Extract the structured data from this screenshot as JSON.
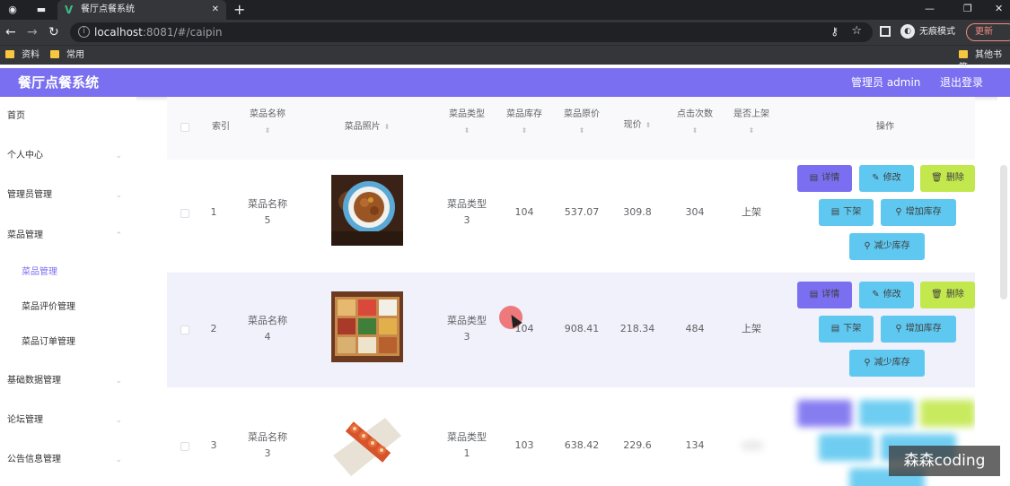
{
  "browser": {
    "tab_title": "餐厅点餐系统",
    "url_host": "localhost",
    "url_rest": ":8081/#/caipin",
    "incognito_label": "无痕模式",
    "update_label": "更新",
    "bookmarks": [
      "资料",
      "常用"
    ],
    "other_bookmarks": "其他书签"
  },
  "header": {
    "title": "餐厅点餐系统",
    "admin": "管理员 admin",
    "logout": "退出登录",
    "accent": "#7a6ff0"
  },
  "sidebar": {
    "items": [
      {
        "label": "首页"
      },
      {
        "label": "个人中心"
      },
      {
        "label": "管理员管理"
      },
      {
        "label": "菜品管理"
      },
      {
        "label": "菜品管理"
      },
      {
        "label": "菜品评价管理"
      },
      {
        "label": "菜品订单管理"
      },
      {
        "label": "基础数据管理"
      },
      {
        "label": "论坛管理"
      },
      {
        "label": "公告信息管理"
      }
    ]
  },
  "table": {
    "headers": {
      "index": "索引",
      "name": "菜品名称",
      "photo": "菜品照片",
      "type": "菜品类型",
      "stock": "菜品库存",
      "orig_price": "菜品原价",
      "price": "现价",
      "clicks": "点击次数",
      "onsale": "是否上架",
      "actions": "操作"
    },
    "rows": [
      {
        "index": "1",
        "name_a": "菜品名称",
        "name_b": "5",
        "type_a": "菜品类型",
        "type_b": "3",
        "stock": "104",
        "orig_price": "537.07",
        "price": "309.8",
        "clicks": "304",
        "onsale": "上架"
      },
      {
        "index": "2",
        "name_a": "菜品名称",
        "name_b": "4",
        "type_a": "菜品类型",
        "type_b": "3",
        "stock": "104",
        "orig_price": "908.41",
        "price": "218.34",
        "clicks": "484",
        "onsale": "上架"
      },
      {
        "index": "3",
        "name_a": "菜品名称",
        "name_b": "3",
        "type_a": "菜品类型",
        "type_b": "1",
        "stock": "103",
        "orig_price": "638.42",
        "price": "229.6",
        "clicks": "134",
        "onsale": ""
      }
    ],
    "buttons": {
      "detail": "详情",
      "edit": "修改",
      "delete": "删除",
      "off_shelf": "下架",
      "add_stock": "增加库存",
      "reduce_stock": "减少库存"
    }
  },
  "watermark": "森森coding"
}
